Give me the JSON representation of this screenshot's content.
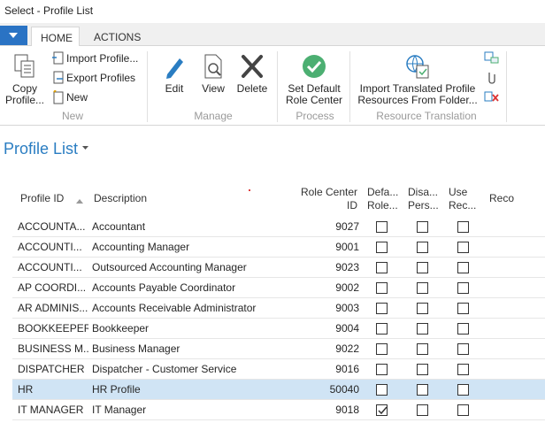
{
  "window": {
    "title": "Select - Profile List"
  },
  "ribbon_tabs": [
    {
      "label": "HOME",
      "active": true
    },
    {
      "label": "ACTIONS",
      "active": false
    }
  ],
  "ribbon": {
    "groups": {
      "new": "New",
      "manage": "Manage",
      "process": "Process",
      "resource_translation": "Resource Translation"
    },
    "buttons": {
      "copy_profile_line1": "Copy",
      "copy_profile_line2": "Profile...",
      "import_profile": "Import Profile...",
      "export_profiles": "Export Profiles",
      "new": "New",
      "edit": "Edit",
      "view": "View",
      "delete": "Delete",
      "set_default_line1": "Set Default",
      "set_default_line2": "Role Center",
      "import_translated_line1": "Import Translated Profile",
      "import_translated_line2": "Resources From Folder..."
    }
  },
  "page": {
    "title": "Profile List"
  },
  "columns": {
    "profile_id": "Profile ID",
    "description": "Description",
    "role_center_line1": "Role Center",
    "role_center_line2": "ID",
    "default_line1": "Defa...",
    "default_line2": "Role...",
    "disable_line1": "Disa...",
    "disable_line2": "Pers...",
    "use_line1": "Use",
    "use_line2": "Rec...",
    "reco": "Reco"
  },
  "rows": [
    {
      "id": "ACCOUNTA...",
      "desc": "Accountant",
      "rc": "9027",
      "def": false,
      "dis": false,
      "use": false,
      "selected": false
    },
    {
      "id": "ACCOUNTI...",
      "desc": "Accounting Manager",
      "rc": "9001",
      "def": false,
      "dis": false,
      "use": false,
      "selected": false
    },
    {
      "id": "ACCOUNTI...",
      "desc": "Outsourced Accounting Manager",
      "rc": "9023",
      "def": false,
      "dis": false,
      "use": false,
      "selected": false
    },
    {
      "id": "AP COORDI...",
      "desc": "Accounts Payable Coordinator",
      "rc": "9002",
      "def": false,
      "dis": false,
      "use": false,
      "selected": false
    },
    {
      "id": "AR ADMINIS...",
      "desc": "Accounts Receivable Administrator",
      "rc": "9003",
      "def": false,
      "dis": false,
      "use": false,
      "selected": false
    },
    {
      "id": "BOOKKEEPER",
      "desc": "Bookkeeper",
      "rc": "9004",
      "def": false,
      "dis": false,
      "use": false,
      "selected": false
    },
    {
      "id": "BUSINESS M...",
      "desc": "Business Manager",
      "rc": "9022",
      "def": false,
      "dis": false,
      "use": false,
      "selected": false
    },
    {
      "id": "DISPATCHER",
      "desc": "Dispatcher - Customer Service",
      "rc": "9016",
      "def": false,
      "dis": false,
      "use": false,
      "selected": false
    },
    {
      "id": "HR",
      "desc": "HR Profile",
      "rc": "50040",
      "def": false,
      "dis": false,
      "use": false,
      "selected": true
    },
    {
      "id": "IT MANAGER",
      "desc": "IT Manager",
      "rc": "9018",
      "def": true,
      "dis": false,
      "use": false,
      "selected": false
    }
  ],
  "colors": {
    "accent": "#2a7dc2",
    "app_menu": "#2a73c4",
    "selected_row": "#d0e4f5",
    "group_label": "#9a9a9a",
    "set_default_green": "#4caf72",
    "delete_red": "#d33"
  }
}
